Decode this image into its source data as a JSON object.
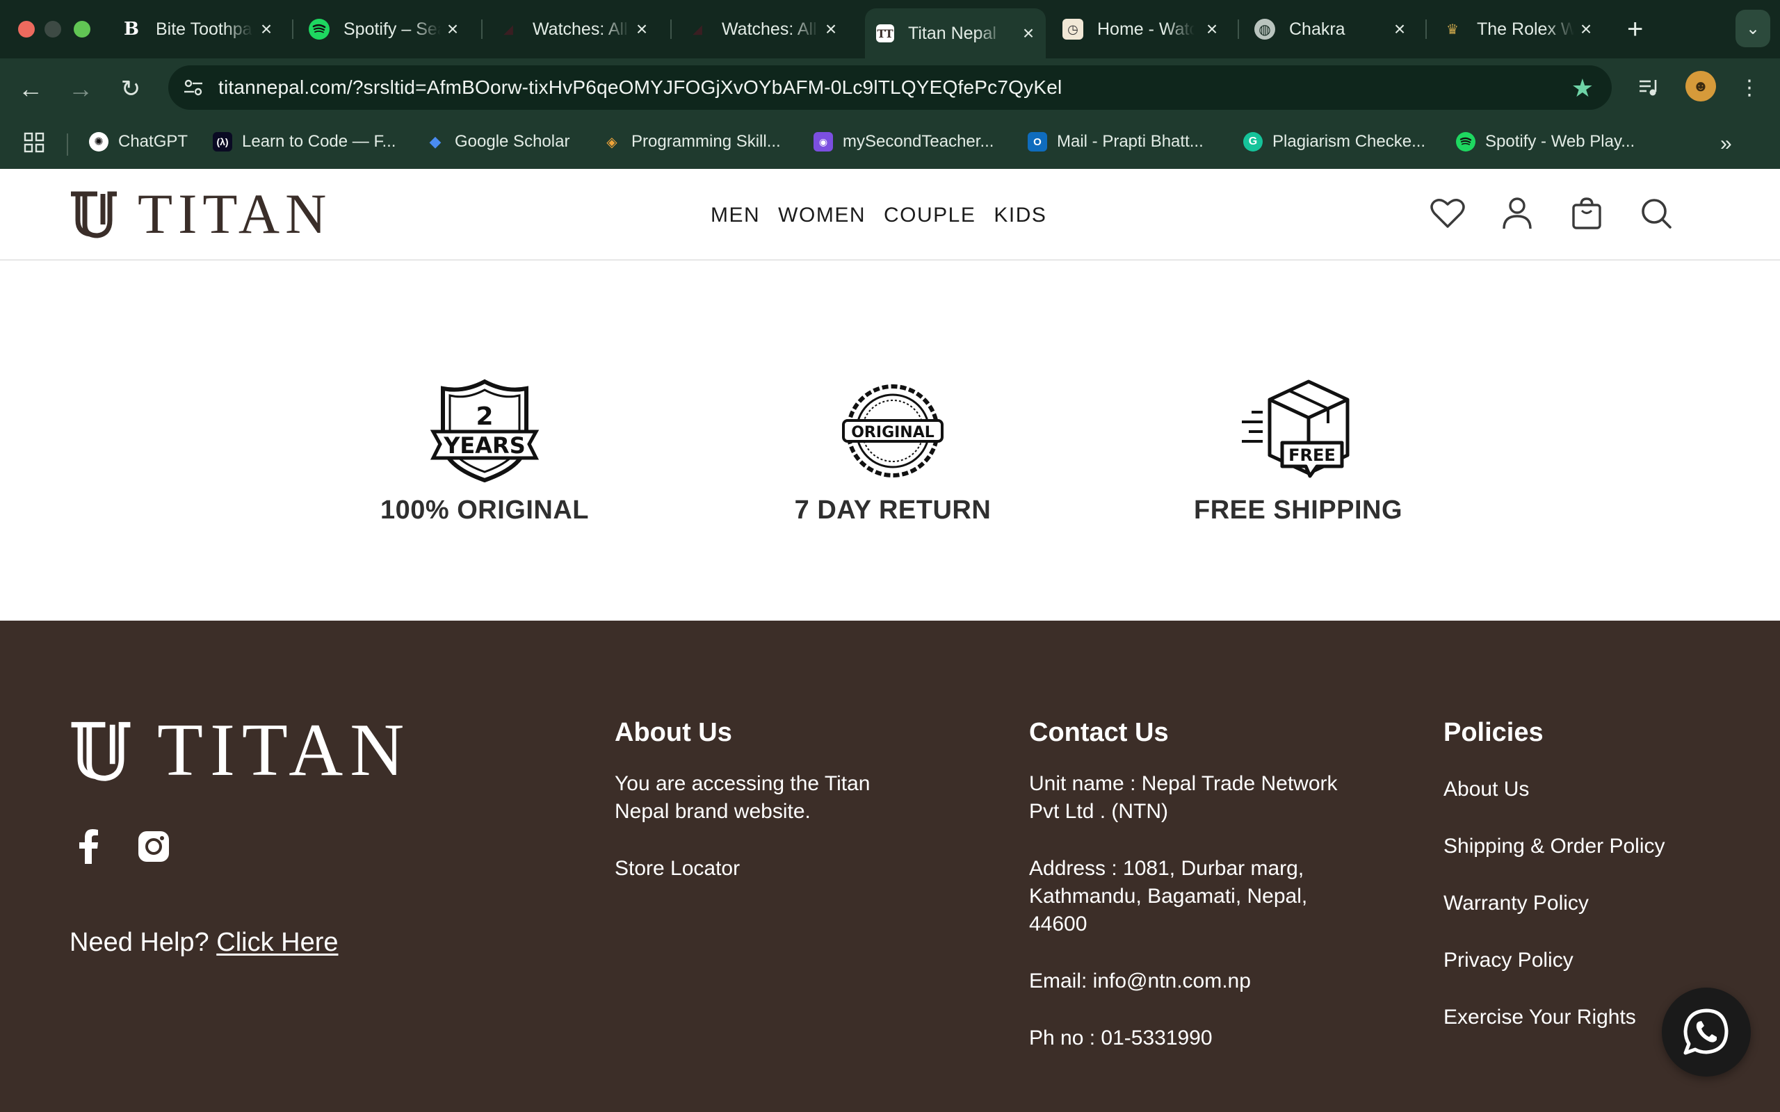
{
  "browser": {
    "tabs": [
      {
        "title": "Bite Toothpaste",
        "favicon": "B"
      },
      {
        "title": "Spotify – Search",
        "favicon": "spotify-icon"
      },
      {
        "title": "Watches: All",
        "favicon": "dark-icon"
      },
      {
        "title": "Watches: All",
        "favicon": "dark-icon"
      },
      {
        "title": "Titan Nepal",
        "favicon": "titan-icon",
        "active": true
      },
      {
        "title": "Home - Watches",
        "favicon": "clock-icon"
      },
      {
        "title": "Chakra",
        "favicon": "globe-icon"
      },
      {
        "title": "The Rolex Watch",
        "favicon": "crown-icon"
      }
    ],
    "url": "titannepal.com/?srsltid=AfmBOorw-tixHvP6qeOMYJFOGjXvOYbAFM-0Lc9lTLQYEQfePc7QyKel",
    "bookmarks": [
      {
        "label": "ChatGPT"
      },
      {
        "label": "Learn to Code — F..."
      },
      {
        "label": "Google Scholar"
      },
      {
        "label": "Programming Skill..."
      },
      {
        "label": "mySecondTeacher..."
      },
      {
        "label": "Mail - Prapti Bhatt..."
      },
      {
        "label": "Plagiarism Checke..."
      },
      {
        "label": "Spotify - Web Play..."
      }
    ]
  },
  "header": {
    "logo_text": "TITAN",
    "nav": [
      "MEN",
      "WOMEN",
      "COUPLE",
      "KIDS"
    ]
  },
  "features": [
    {
      "badge_num": "2",
      "badge_text": "YEARS",
      "label": "100% ORIGINAL"
    },
    {
      "badge_text": "ORIGINAL",
      "label": "7 DAY RETURN"
    },
    {
      "badge_text": "FREE",
      "label": "FREE SHIPPING"
    }
  ],
  "footer": {
    "logo_text": "TITAN",
    "help_prefix": "Need Help?",
    "help_link": "Click Here",
    "about": {
      "heading": "About Us",
      "text": "You are accessing the Titan Nepal brand website.",
      "store_locator": "Store Locator"
    },
    "contact": {
      "heading": "Contact Us",
      "unit": "Unit name : Nepal Trade Network Pvt Ltd . (NTN)",
      "address": "Address : 1081, Durbar marg, Kathmandu, Bagamati, Nepal, 44600",
      "email": "Email: info@ntn.com.np",
      "phone": "Ph no : 01-5331990"
    },
    "policies": {
      "heading": "Policies",
      "links": [
        "About Us",
        "Shipping & Order Policy",
        "Warranty Policy",
        "Privacy Policy",
        "Exercise Your Rights"
      ]
    }
  },
  "colors": {
    "browser_dark": "#13281f",
    "browser_toolbar": "#1f3a2e",
    "footer_bg": "#3c2e28",
    "brand_text": "#3a2e29"
  }
}
